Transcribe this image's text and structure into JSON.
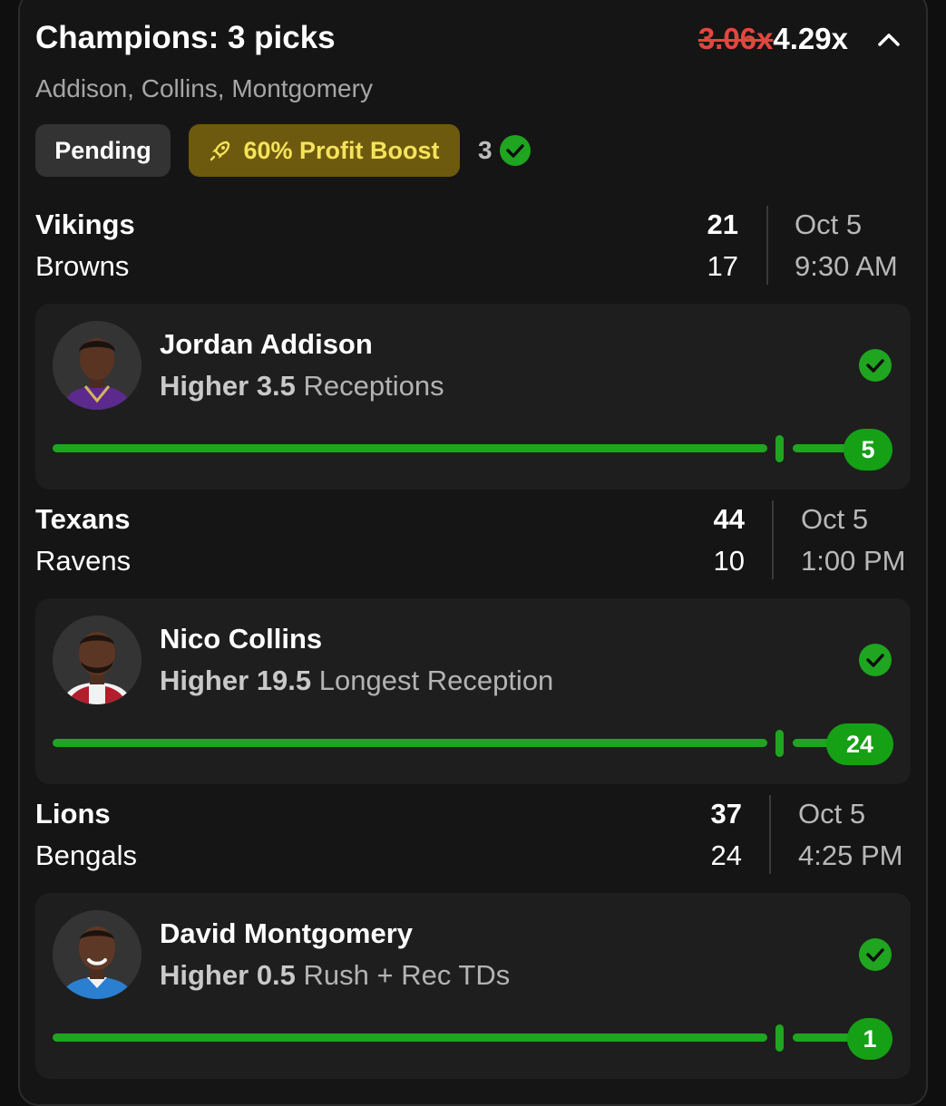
{
  "header": {
    "title": "Champions: 3 picks",
    "old_multiplier": "3.06x",
    "new_multiplier": "4.29x",
    "players_summary": "Addison, Collins, Montgomery"
  },
  "badges": {
    "status": "Pending",
    "boost": "60% Profit Boost",
    "hit_count": "3"
  },
  "colors": {
    "accent_green": "#1fa51f",
    "boost_bg": "#6e5a0e",
    "boost_text": "#f5e35a",
    "old_multiplier": "#e0483f"
  },
  "games": [
    {
      "team1": "Vikings",
      "score1": "21",
      "team2": "Browns",
      "score2": "17",
      "date": "Oct 5",
      "time": "9:30 AM",
      "pick": {
        "player": "Jordan Addison",
        "direction": "Higher",
        "line": "3.5",
        "stat": "Receptions",
        "result": "5",
        "status_icon": "check-circle-icon"
      }
    },
    {
      "team1": "Texans",
      "score1": "44",
      "team2": "Ravens",
      "score2": "10",
      "date": "Oct 5",
      "time": "1:00 PM",
      "pick": {
        "player": "Nico Collins",
        "direction": "Higher",
        "line": "19.5",
        "stat": "Longest Reception",
        "result": "24",
        "status_icon": "check-circle-icon"
      }
    },
    {
      "team1": "Lions",
      "score1": "37",
      "team2": "Bengals",
      "score2": "24",
      "date": "Oct 5",
      "time": "4:25 PM",
      "pick": {
        "player": "David Montgomery",
        "direction": "Higher",
        "line": "0.5",
        "stat": "Rush + Rec TDs",
        "result": "1",
        "status_icon": "check-circle-icon"
      }
    }
  ]
}
